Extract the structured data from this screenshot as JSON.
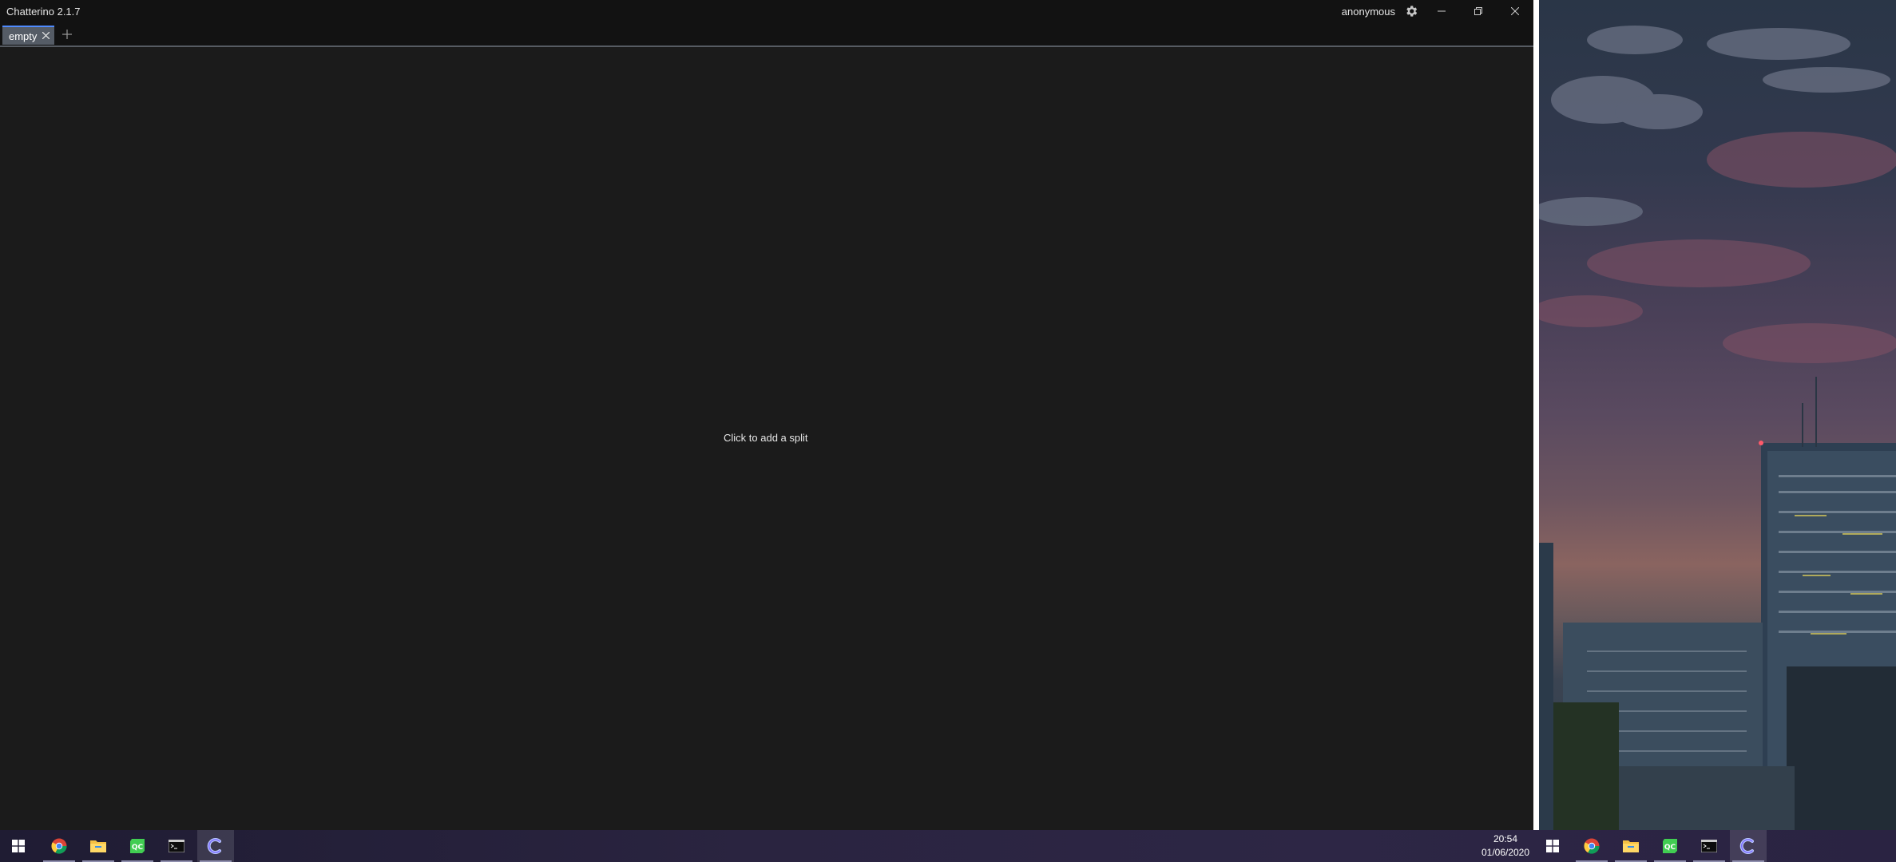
{
  "window": {
    "title": "Chatterino 2.1.7",
    "account": "anonymous",
    "controls": {
      "settings_icon": "gear-icon",
      "minimize_icon": "minimize-icon",
      "restore_icon": "restore-icon",
      "close_icon": "close-icon"
    }
  },
  "tabs": [
    {
      "label": "empty",
      "active": true
    }
  ],
  "add_tab_icon": "plus-icon",
  "split": {
    "hint": "Click to add a split"
  },
  "taskbar": {
    "left_items": [
      "windows-start-icon",
      "chrome-icon",
      "file-explorer-icon",
      "qt-creator-icon",
      "terminal-icon",
      "chatterino-icon"
    ],
    "right_items": [
      "windows-start-icon",
      "chrome-icon",
      "file-explorer-icon",
      "qt-creator-icon",
      "terminal-icon",
      "chatterino-icon"
    ],
    "clock": {
      "time": "20:54",
      "date": "01/06/2020"
    }
  },
  "colors": {
    "window_bg": "#1b1b1b",
    "titlebar_bg": "#121212",
    "tab_active_bg": "#555c66",
    "tab_accent": "#4f8bff"
  }
}
